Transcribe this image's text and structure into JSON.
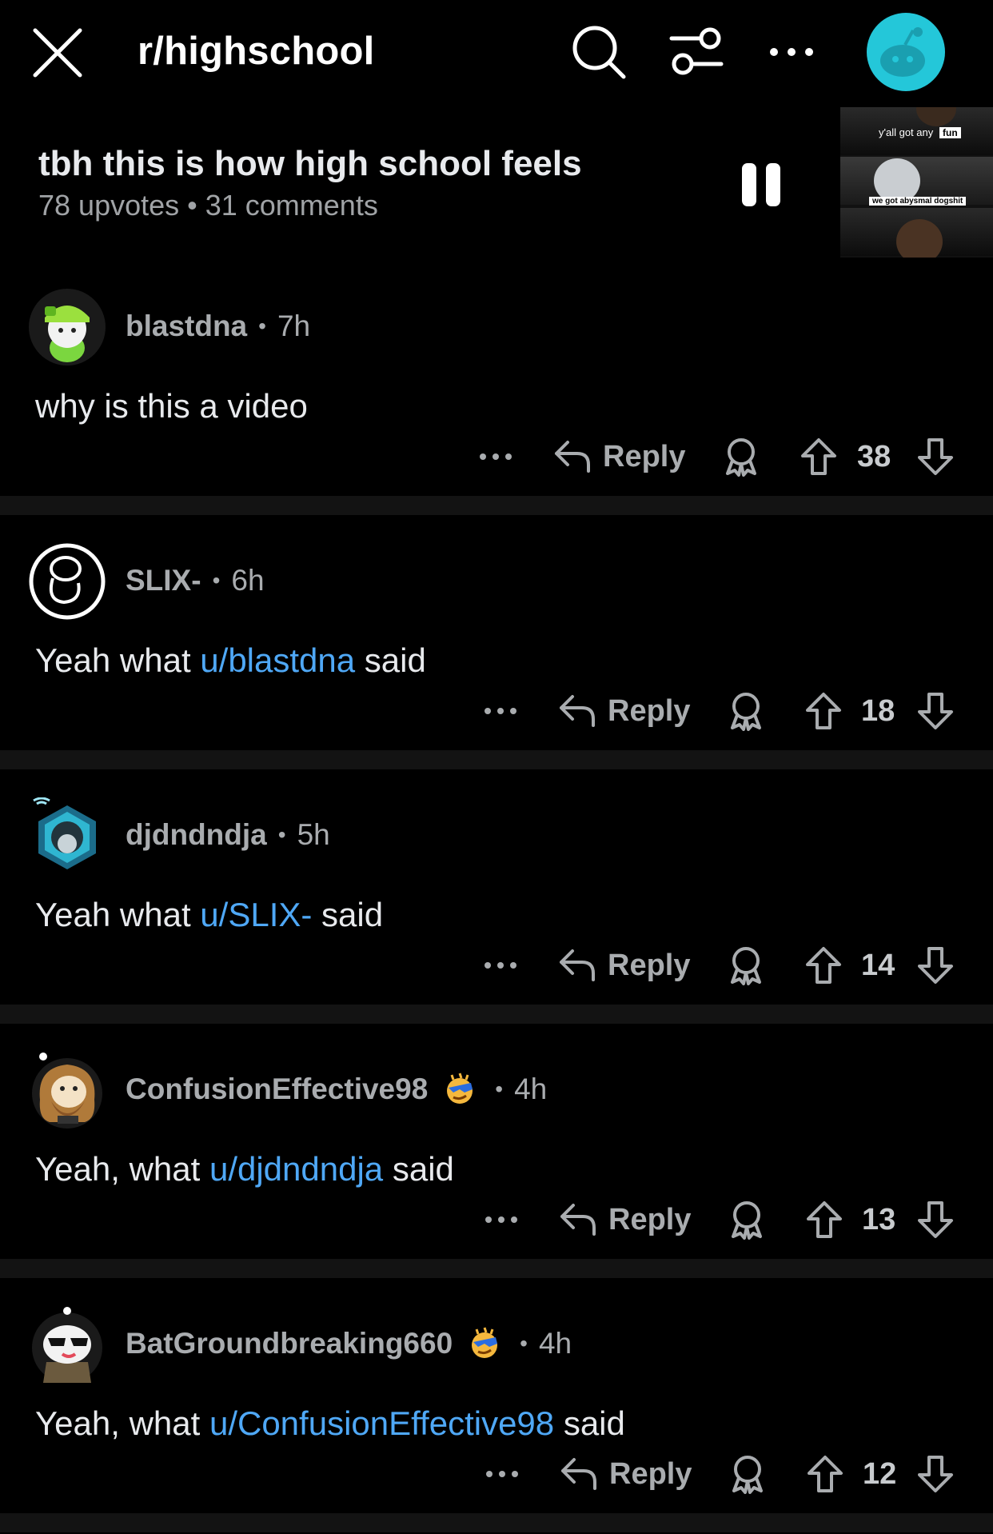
{
  "header": {
    "subreddit": "r/highschool",
    "close_icon": "close-icon",
    "search_icon": "search-icon",
    "filter_icon": "sort-filter-icon",
    "more_icon": "more-horizontal-icon",
    "avatar_icon": "reddit-snoo-avatar",
    "avatar_color": "#24c7d9"
  },
  "post": {
    "title": "tbh this is how high school feels",
    "meta": "78 upvotes • 31 comments",
    "pause_icon": "pause-icon",
    "thumbnail": {
      "caption_top": "y'all got any",
      "caption_top_tag": "fun",
      "caption_middle": "we got abysmal dogshit"
    }
  },
  "comments": [
    {
      "author": "blastdna",
      "time": "7h",
      "text_before": "why is this a video",
      "mention": "",
      "text_after": "",
      "reply_label": "Reply",
      "score": "38",
      "has_badge": false
    },
    {
      "author": "SLIX-",
      "time": "6h",
      "text_before": "Yeah what ",
      "mention": "u/blastdna",
      "text_after": " said",
      "reply_label": "Reply",
      "score": "18",
      "has_badge": false
    },
    {
      "author": "djdndndja",
      "time": "5h",
      "text_before": "Yeah what ",
      "mention": "u/SLIX-",
      "text_after": " said",
      "reply_label": "Reply",
      "score": "14",
      "has_badge": false
    },
    {
      "author": "ConfusionEffective98",
      "time": "4h",
      "text_before": "Yeah, what ",
      "mention": "u/djdndndja",
      "text_after": " said",
      "reply_label": "Reply",
      "score": "13",
      "has_badge": true
    },
    {
      "author": "BatGroundbreaking660",
      "time": "4h",
      "text_before": "Yeah, what ",
      "mention": "u/ConfusionEffective98",
      "text_after": " said",
      "reply_label": "Reply",
      "score": "12",
      "has_badge": true
    }
  ],
  "colors": {
    "background": "#000000",
    "separator": "#131313",
    "mention_link": "#4fa8f6",
    "muted_text": "#a9acaf",
    "badge": "#f5b83d"
  },
  "icons": {
    "more": "more-horizontal-icon",
    "reply": "reply-arrow-icon",
    "award": "award-icon",
    "upvote": "upvote-arrow-icon",
    "downvote": "downvote-arrow-icon",
    "badge": "cool-sun-emoji-icon"
  }
}
